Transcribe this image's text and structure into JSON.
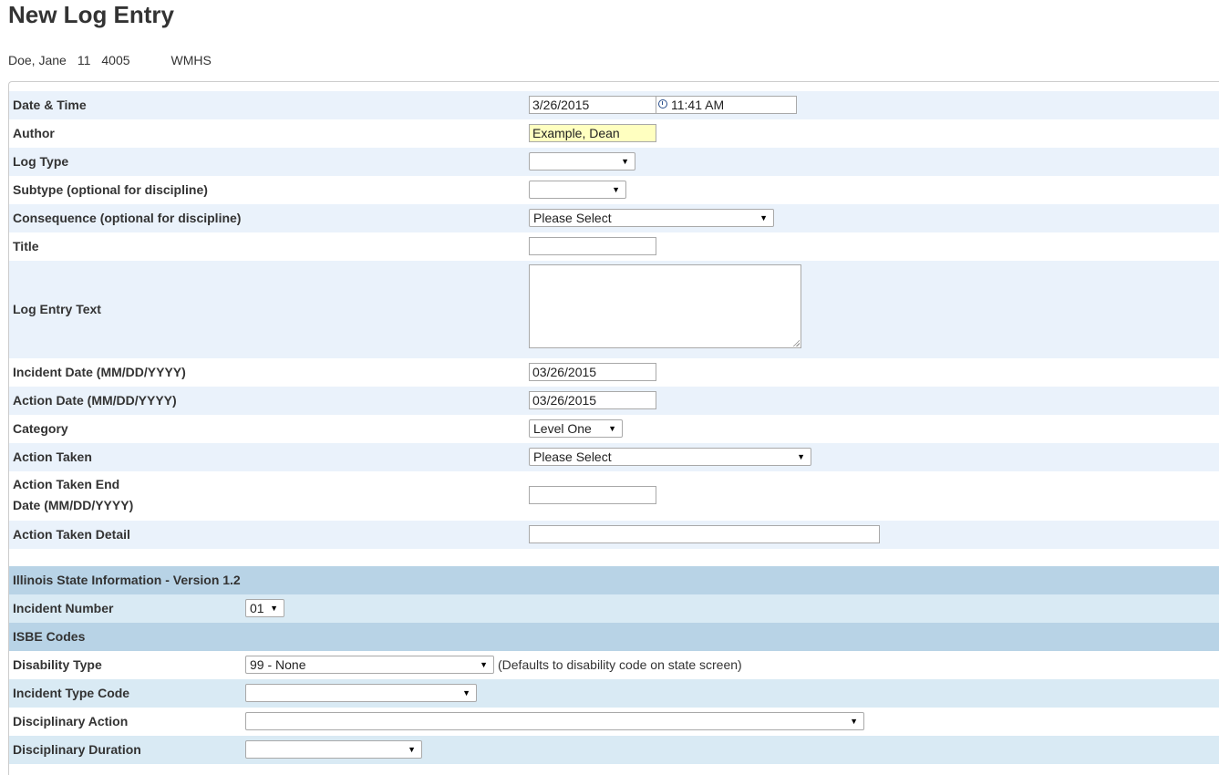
{
  "page": {
    "title": "New Log Entry"
  },
  "student": {
    "name": "Doe, Jane",
    "grade": "11",
    "id": "4005",
    "school": "WMHS"
  },
  "form": {
    "date_time": {
      "label": "Date & Time",
      "date": "3/26/2015",
      "time": "11:41 AM"
    },
    "author": {
      "label": "Author",
      "value": "Example, Dean"
    },
    "log_type": {
      "label": "Log Type",
      "value": ""
    },
    "subtype": {
      "label": "Subtype (optional for discipline)",
      "value": ""
    },
    "consequence": {
      "label": "Consequence (optional for discipline)",
      "value": "Please Select"
    },
    "title": {
      "label": "Title",
      "value": ""
    },
    "log_entry_text": {
      "label": "Log Entry Text",
      "value": ""
    },
    "incident_date": {
      "label": "Incident Date (MM/DD/YYYY)",
      "value": "03/26/2015"
    },
    "action_date": {
      "label": "Action Date (MM/DD/YYYY)",
      "value": "03/26/2015"
    },
    "category": {
      "label": "Category",
      "value": "Level One"
    },
    "action_taken": {
      "label": "Action Taken",
      "value": "Please Select"
    },
    "action_taken_end_date": {
      "label_line1": "Action Taken End",
      "label_line2": "Date (MM/DD/YYYY)",
      "value": ""
    },
    "action_taken_detail": {
      "label": "Action Taken Detail",
      "value": ""
    }
  },
  "state_section": {
    "header": "Illinois State Information - Version 1.2",
    "incident_number": {
      "label": "Incident Number",
      "value": "01"
    },
    "isbe_header": "ISBE Codes",
    "disability_type": {
      "label": "Disability Type",
      "value": "99 - None",
      "note": "(Defaults to disability code on state screen)"
    },
    "incident_type_code": {
      "label": "Incident Type Code",
      "value": ""
    },
    "disciplinary_action": {
      "label": "Disciplinary Action",
      "value": ""
    },
    "disciplinary_duration": {
      "label": "Disciplinary Duration",
      "value": ""
    }
  },
  "colors": {
    "row_alt": "#eaf2fb",
    "state_row": "#d9eaf4",
    "state_header": "#b8d3e6",
    "author_highlight": "#ffffc0",
    "clock_icon": "#2a4f8c"
  }
}
